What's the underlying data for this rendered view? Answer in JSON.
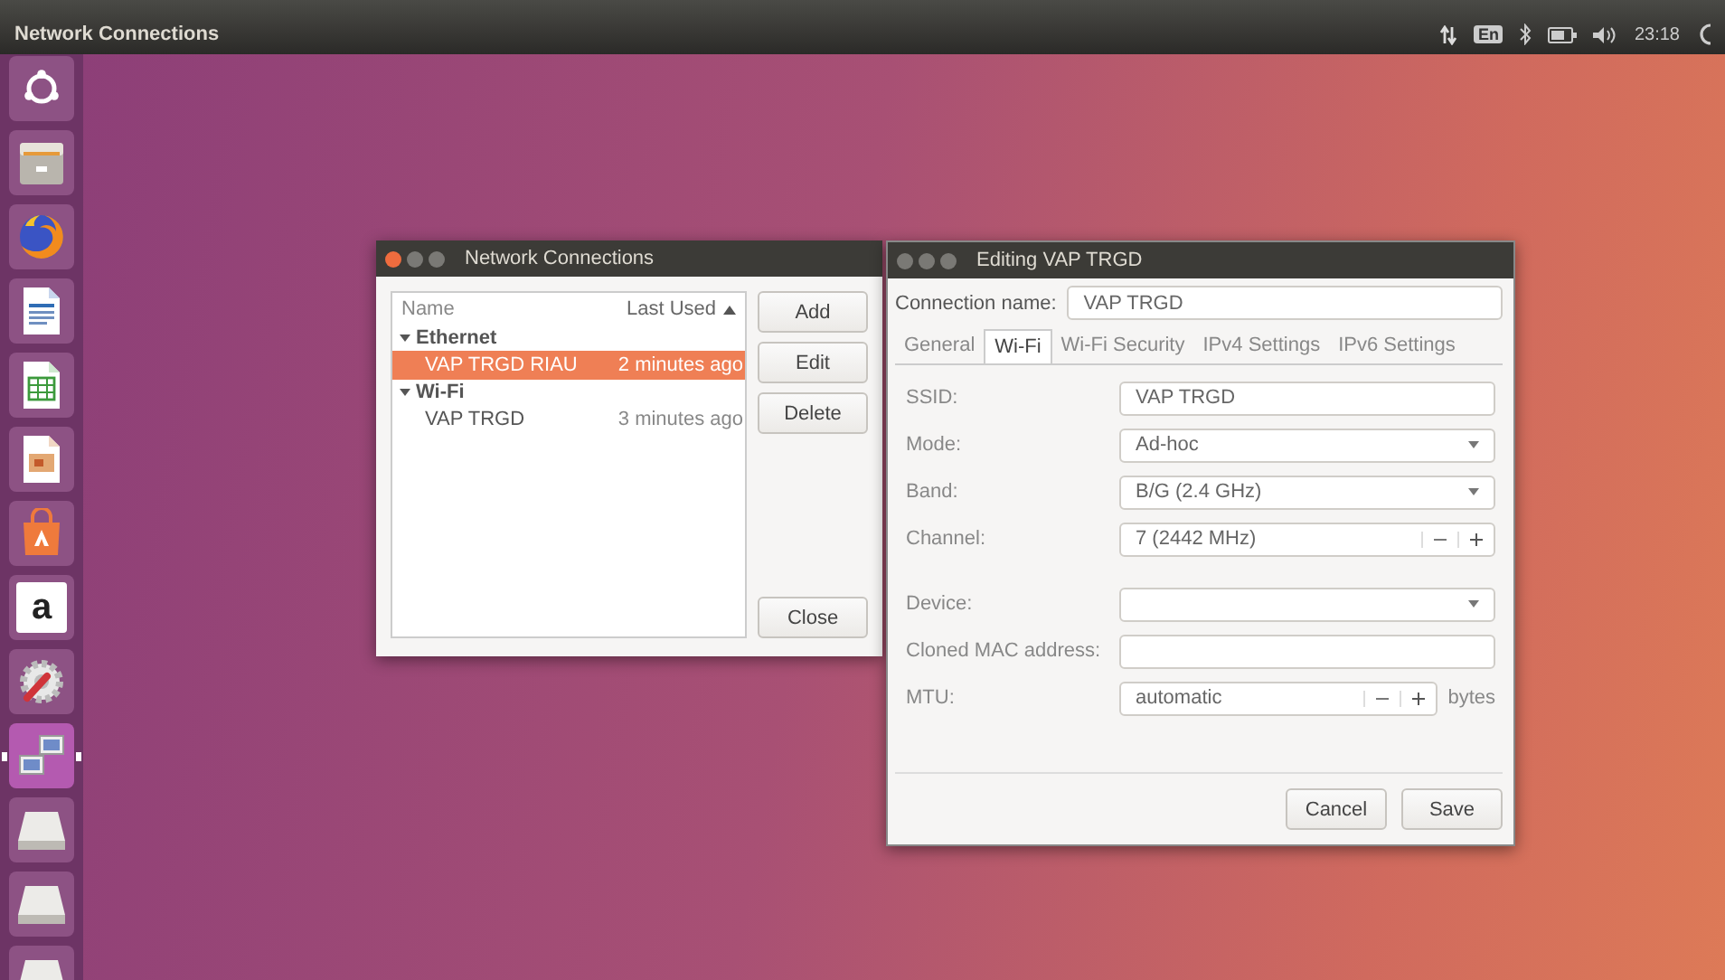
{
  "top_bar": {
    "title": "Network Connections",
    "keyboard": "En",
    "clock": "23:18"
  },
  "launcher": [
    {
      "kind": "ubuntu",
      "active": false
    },
    {
      "kind": "files",
      "active": false
    },
    {
      "kind": "browser",
      "active": false
    },
    {
      "kind": "writer",
      "active": false
    },
    {
      "kind": "calc",
      "active": false
    },
    {
      "kind": "impress",
      "active": false
    },
    {
      "kind": "software",
      "active": false
    },
    {
      "kind": "store",
      "label": "a",
      "active": false
    },
    {
      "kind": "settings",
      "active": false
    },
    {
      "kind": "network",
      "active": true
    },
    {
      "kind": "drive",
      "active": false
    },
    {
      "kind": "drive",
      "active": false
    },
    {
      "kind": "drive",
      "active": false
    }
  ],
  "connections_window": {
    "title": "Network Connections",
    "columns": [
      "Name",
      "Last Used"
    ],
    "groups": [
      {
        "name": "Ethernet",
        "expanded": true,
        "children": [
          {
            "name": "VAP TRGD RIAU",
            "last_used": "2 minutes ago",
            "selected": true
          }
        ]
      },
      {
        "name": "Wi-Fi",
        "expanded": true,
        "children": [
          {
            "name": "VAP TRGD",
            "last_used": "3 minutes ago",
            "selected": false
          }
        ]
      }
    ],
    "buttons": [
      "Add",
      "Edit",
      "Delete"
    ],
    "close_button": "Close"
  },
  "editor_window": {
    "title": "Editing VAP TRGD",
    "connection_name_label": "Connection name:",
    "connection_name": "VAP TRGD",
    "tabs": [
      {
        "label": "General",
        "selected": false
      },
      {
        "label": "Wi-Fi",
        "selected": true
      },
      {
        "label": "Wi-Fi Security",
        "selected": false
      },
      {
        "label": "IPv4 Settings",
        "selected": false
      },
      {
        "label": "IPv6 Settings",
        "selected": false
      }
    ],
    "sections": [
      {
        "rows": [
          {
            "kind": "text",
            "label": "SSID:",
            "value": "VAP TRGD"
          },
          {
            "kind": "combo",
            "label": "Mode:",
            "value": "Ad-hoc"
          },
          {
            "kind": "combo",
            "label": "Band:",
            "value": "B/G (2.4 GHz)"
          },
          {
            "kind": "spin",
            "label": "Channel:",
            "value": "7 (2442 MHz)"
          }
        ]
      },
      {
        "rows": [
          {
            "kind": "combo",
            "label": "Device:"
          },
          {
            "kind": "text",
            "label": "Cloned MAC address:"
          },
          {
            "kind": "spin",
            "label": "MTU:",
            "value": "automatic",
            "unit": "bytes"
          }
        ]
      }
    ],
    "buttons": [
      "Cancel",
      "Save"
    ]
  }
}
